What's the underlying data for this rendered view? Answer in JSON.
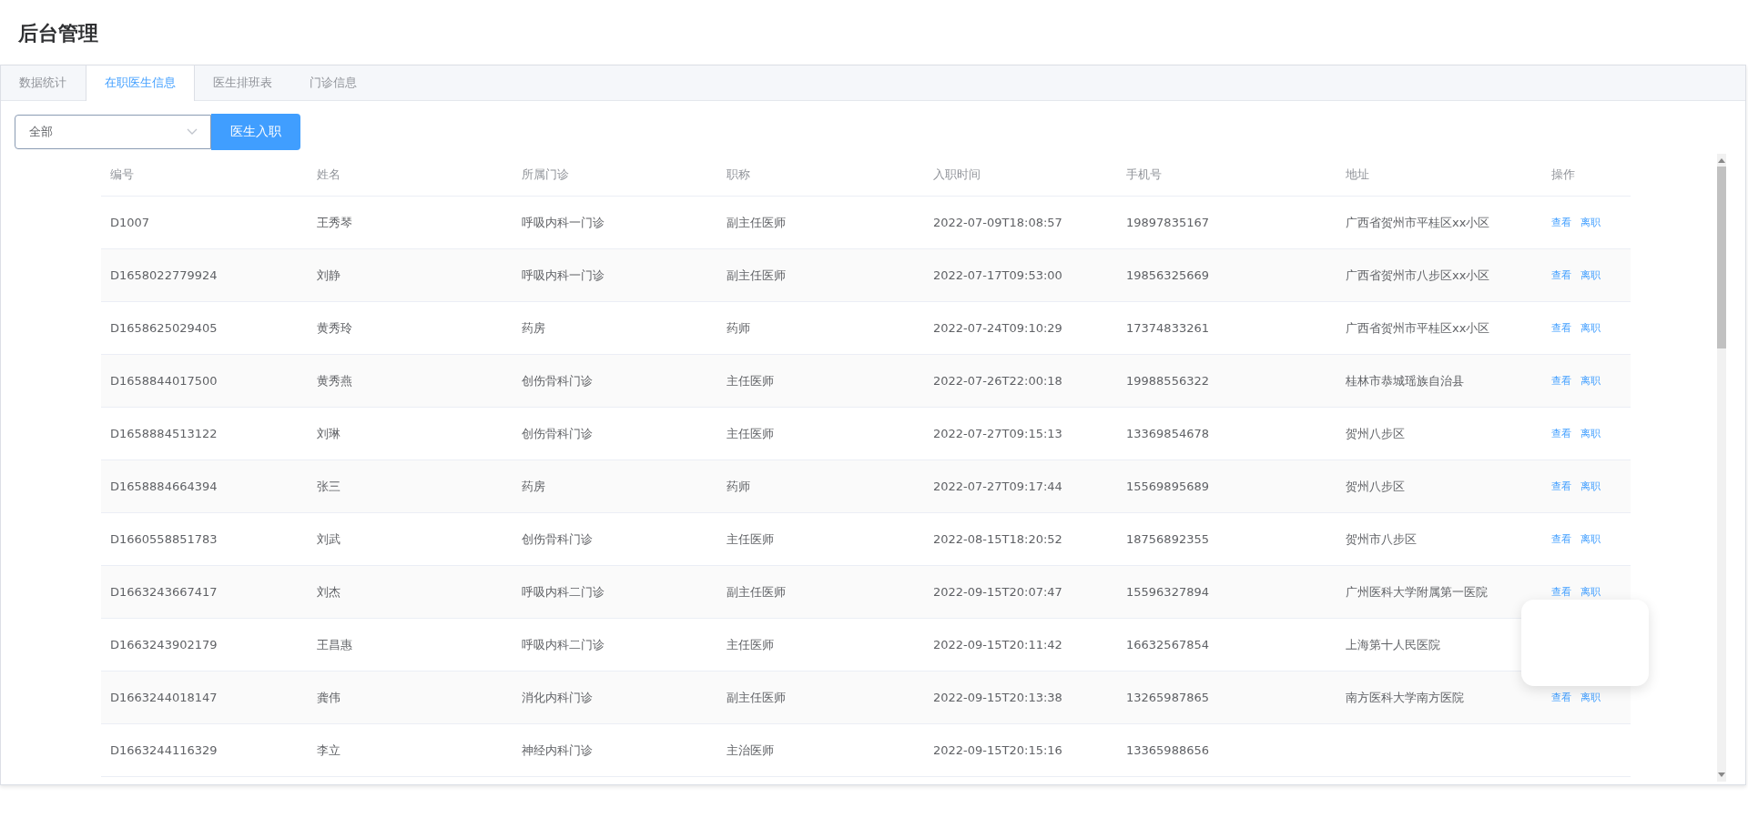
{
  "title": "后台管理",
  "tabs": [
    {
      "label": "数据统计",
      "selected": false
    },
    {
      "label": "在职医生信息",
      "selected": true
    },
    {
      "label": "医生排班表",
      "selected": false
    },
    {
      "label": "门诊信息",
      "selected": false
    }
  ],
  "filter": {
    "value": "全部"
  },
  "add_button": "医生入职",
  "table": {
    "columns": [
      "编号",
      "姓名",
      "所属门诊",
      "职称",
      "入职时间",
      "手机号",
      "地址",
      "操作"
    ],
    "rows": [
      {
        "cells": [
          "D1007",
          "王秀琴",
          "呼吸内科一门诊",
          "副主任医师",
          "2022-07-09T18:08:57",
          "19897835167",
          "广西省贺州市平桂区xx小区"
        ],
        "actions": [
          "查看",
          "离职"
        ]
      },
      {
        "cells": [
          "D1658022779924",
          "刘静",
          "呼吸内科一门诊",
          "副主任医师",
          "2022-07-17T09:53:00",
          "19856325669",
          "广西省贺州市八步区xx小区"
        ],
        "actions": [
          "查看",
          "离职"
        ]
      },
      {
        "cells": [
          "D1658625029405",
          "黄秀玲",
          "药房",
          "药师",
          "2022-07-24T09:10:29",
          "17374833261",
          "广西省贺州市平桂区xx小区"
        ],
        "actions": [
          "查看",
          "离职"
        ]
      },
      {
        "cells": [
          "D1658844017500",
          "黄秀燕",
          "创伤骨科门诊",
          "主任医师",
          "2022-07-26T22:00:18",
          "19988556322",
          "桂林市恭城瑶族自治县"
        ],
        "actions": [
          "查看",
          "离职"
        ]
      },
      {
        "cells": [
          "D1658884513122",
          "刘琳",
          "创伤骨科门诊",
          "主任医师",
          "2022-07-27T09:15:13",
          "13369854678",
          "贺州八步区"
        ],
        "actions": [
          "查看",
          "离职"
        ]
      },
      {
        "cells": [
          "D1658884664394",
          "张三",
          "药房",
          "药师",
          "2022-07-27T09:17:44",
          "15569895689",
          "贺州八步区"
        ],
        "actions": [
          "查看",
          "离职"
        ]
      },
      {
        "cells": [
          "D1660558851783",
          "刘武",
          "创伤骨科门诊",
          "主任医师",
          "2022-08-15T18:20:52",
          "18756892355",
          "贺州市八步区"
        ],
        "actions": [
          "查看",
          "离职"
        ]
      },
      {
        "cells": [
          "D1663243667417",
          "刘杰",
          "呼吸内科二门诊",
          "副主任医师",
          "2022-09-15T20:07:47",
          "15596327894",
          "广州医科大学附属第一医院"
        ],
        "actions": [
          "查看",
          "离职"
        ]
      },
      {
        "cells": [
          "D1663243902179",
          "王昌惠",
          "呼吸内科二门诊",
          "主任医师",
          "2022-09-15T20:11:42",
          "16632567854",
          "上海第十人民医院"
        ],
        "actions": []
      },
      {
        "cells": [
          "D1663244018147",
          "龚伟",
          "消化内科门诊",
          "副主任医师",
          "2022-09-15T20:13:38",
          "13265987865",
          "南方医科大学南方医院"
        ],
        "actions": [
          "查看",
          "离职"
        ]
      },
      {
        "cells": [
          "D1663244116329",
          "李立",
          "神经内科门诊",
          "主治医师",
          "2022-09-15T20:15:16",
          "13365988656"
        ],
        "actions": []
      }
    ]
  }
}
